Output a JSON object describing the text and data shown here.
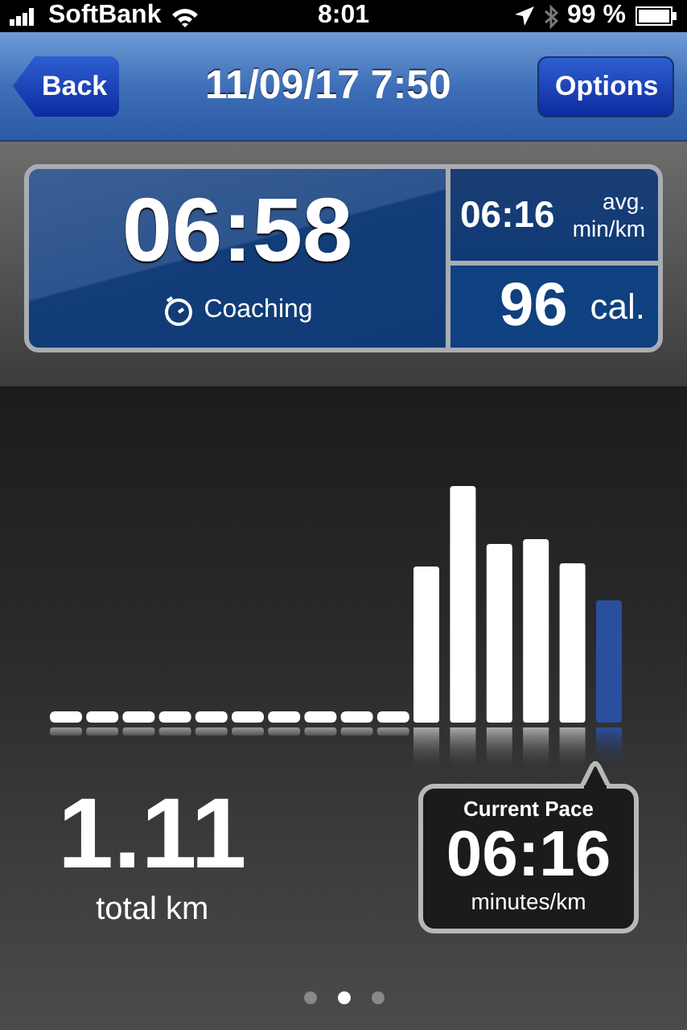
{
  "status_bar": {
    "carrier": "SoftBank",
    "time": "8:01",
    "battery": "99 %"
  },
  "nav_bar": {
    "back": "Back",
    "title": "11/09/17 7:50",
    "options": "Options"
  },
  "summary": {
    "duration": "06:58",
    "coaching": "Coaching",
    "avg_pace": "06:16",
    "avg_label": "avg.",
    "avg_unit": "min/km",
    "calories": "96",
    "calories_unit": "cal."
  },
  "distance": {
    "value": "1.11",
    "label": "total km"
  },
  "current_pace": {
    "title": "Current Pace",
    "value": "06:16",
    "unit": "minutes/km"
  },
  "pages": [
    {
      "selected": false
    },
    {
      "selected": true
    },
    {
      "selected": false
    }
  ]
}
